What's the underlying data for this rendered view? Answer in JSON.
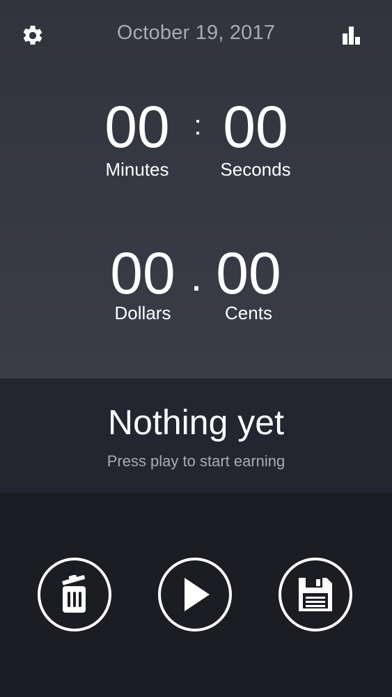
{
  "header": {
    "date": "October 19, 2017",
    "settings_icon": "gear-icon",
    "stats_icon": "bar-chart-icon"
  },
  "timer": {
    "minutes": "00",
    "seconds": "00",
    "separator": ":",
    "minutes_label": "Minutes",
    "seconds_label": "Seconds"
  },
  "earnings": {
    "dollars": "00",
    "cents": "00",
    "separator": ".",
    "dollars_label": "Dollars",
    "cents_label": "Cents"
  },
  "status": {
    "title": "Nothing yet",
    "subtitle": "Press play to start earning"
  },
  "controls": {
    "delete_icon": "trash-icon",
    "play_icon": "play-icon",
    "save_icon": "floppy-disk-icon"
  },
  "colors": {
    "top_panel": "#3a3d48",
    "status_panel": "#232530",
    "bottom_panel": "#1b1d22",
    "muted_text": "#a8abb4",
    "foreground": "#ffffff"
  }
}
